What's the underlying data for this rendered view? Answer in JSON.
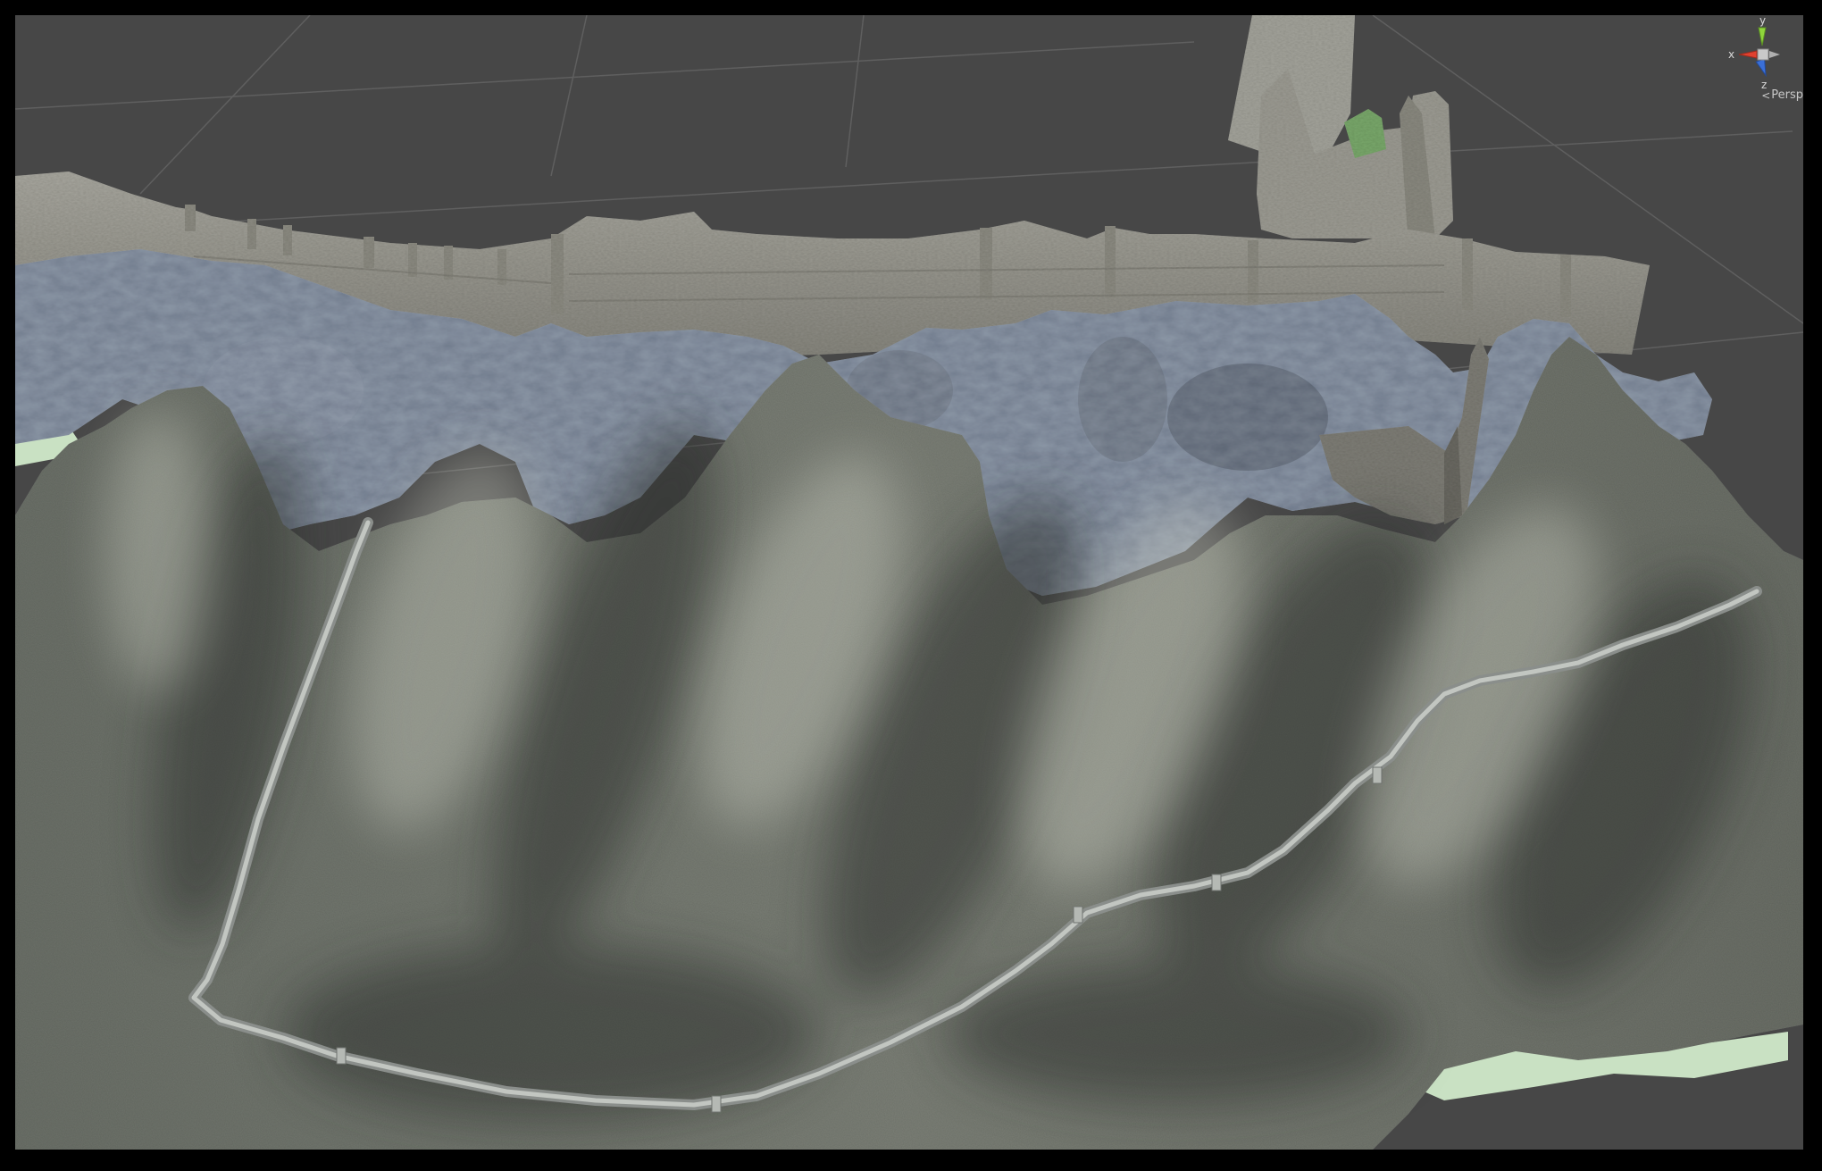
{
  "scene_view": {
    "background_color": "#474747",
    "grid_color": "#5e5e5e",
    "terrain_base_color": "#cfe5c9"
  },
  "gizmo": {
    "axis_x": {
      "label": "x",
      "color": "#e0412f"
    },
    "axis_y": {
      "label": "y",
      "color": "#8fd63b"
    },
    "axis_z": {
      "label": "z",
      "color": "#3a6fd8"
    },
    "center_color": "#c9c9c9",
    "projection_label": "Persp",
    "projection_icon": "chevron-left-icon"
  }
}
